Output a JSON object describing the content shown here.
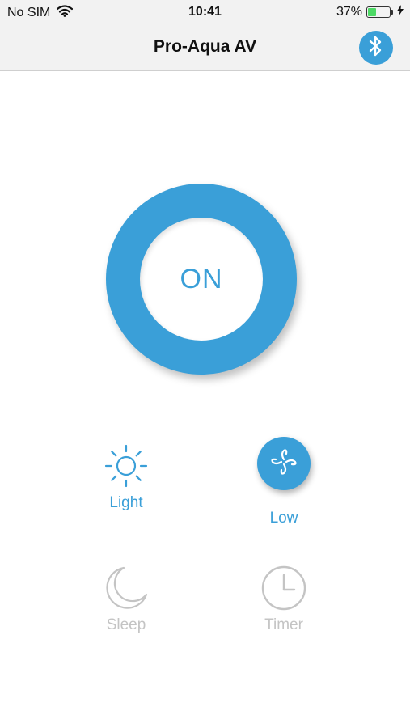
{
  "status_bar": {
    "carrier": "No SIM",
    "time": "10:41",
    "battery_percent": "37%",
    "battery_level": 0.37,
    "battery_color": "#4cd964",
    "icons": [
      "wifi-icon",
      "battery-icon",
      "charging-bolt-icon"
    ]
  },
  "nav": {
    "title": "Pro-Aqua AV",
    "bluetooth_icon": "bluetooth-icon"
  },
  "power": {
    "label": "ON",
    "color": "#3a9fd8"
  },
  "controls": {
    "light": {
      "label": "Light",
      "icon": "sun-icon",
      "active_color": "#3a9fd8"
    },
    "fan": {
      "label": "Low",
      "icon": "fan-icon",
      "active_color": "#3a9fd8"
    },
    "sleep": {
      "label": "Sleep",
      "icon": "moon-icon",
      "inactive_color": "#c4c4c4"
    },
    "timer": {
      "label": "Timer",
      "icon": "clock-icon",
      "inactive_color": "#c4c4c4"
    }
  }
}
